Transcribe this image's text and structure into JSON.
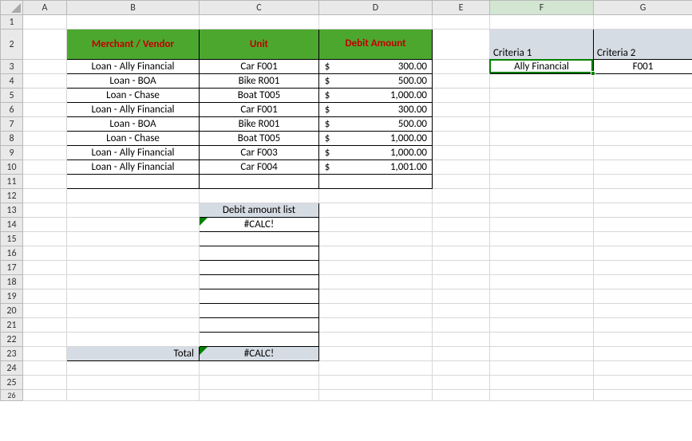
{
  "columns": [
    "A",
    "B",
    "C",
    "D",
    "E",
    "F",
    "G"
  ],
  "rows": [
    "1",
    "2",
    "3",
    "4",
    "5",
    "6",
    "7",
    "8",
    "9",
    "10",
    "11",
    "12",
    "13",
    "14",
    "15",
    "16",
    "17",
    "18",
    "19",
    "20",
    "21",
    "22",
    "23",
    "24",
    "25",
    "26"
  ],
  "activeCell": "F3",
  "header": {
    "merchant": "Merchant / Vendor",
    "unit": "Unit",
    "debit": "Debit Amount"
  },
  "criteria": {
    "label1": "Criteria 1",
    "label2": "Criteria 2",
    "val1": "Ally Financial",
    "val2": "F001"
  },
  "currency": "$",
  "table": [
    {
      "merchant": "Loan - Ally Financial",
      "unit": "Car F001",
      "amount": "300.00"
    },
    {
      "merchant": "Loan - BOA",
      "unit": "Bike R001",
      "amount": "500.00"
    },
    {
      "merchant": "Loan - Chase",
      "unit": "Boat T005",
      "amount": "1,000.00"
    },
    {
      "merchant": "Loan - Ally Financial",
      "unit": "Car F001",
      "amount": "300.00"
    },
    {
      "merchant": "Loan - BOA",
      "unit": "Bike R001",
      "amount": "500.00"
    },
    {
      "merchant": "Loan - Chase",
      "unit": "Boat T005",
      "amount": "1,000.00"
    },
    {
      "merchant": "Loan - Ally Financial",
      "unit": "Car F003",
      "amount": "1,000.00"
    },
    {
      "merchant": "Loan - Ally Financial",
      "unit": "Car F004",
      "amount": "1,001.00"
    }
  ],
  "list": {
    "header": "Debit amount list",
    "err": "#CALC!"
  },
  "total": {
    "label": "Total",
    "err": "#CALC!"
  },
  "chart_data": {
    "type": "table",
    "columns": [
      "Merchant / Vendor",
      "Unit",
      "Debit Amount"
    ],
    "rows": [
      [
        "Loan - Ally Financial",
        "Car F001",
        300.0
      ],
      [
        "Loan - BOA",
        "Bike R001",
        500.0
      ],
      [
        "Loan - Chase",
        "Boat T005",
        1000.0
      ],
      [
        "Loan - Ally Financial",
        "Car F001",
        300.0
      ],
      [
        "Loan - BOA",
        "Bike R001",
        500.0
      ],
      [
        "Loan - Chase",
        "Boat T005",
        1000.0
      ],
      [
        "Loan - Ally Financial",
        "Car F003",
        1000.0
      ],
      [
        "Loan - Ally Financial",
        "Car F004",
        1001.0
      ]
    ]
  }
}
